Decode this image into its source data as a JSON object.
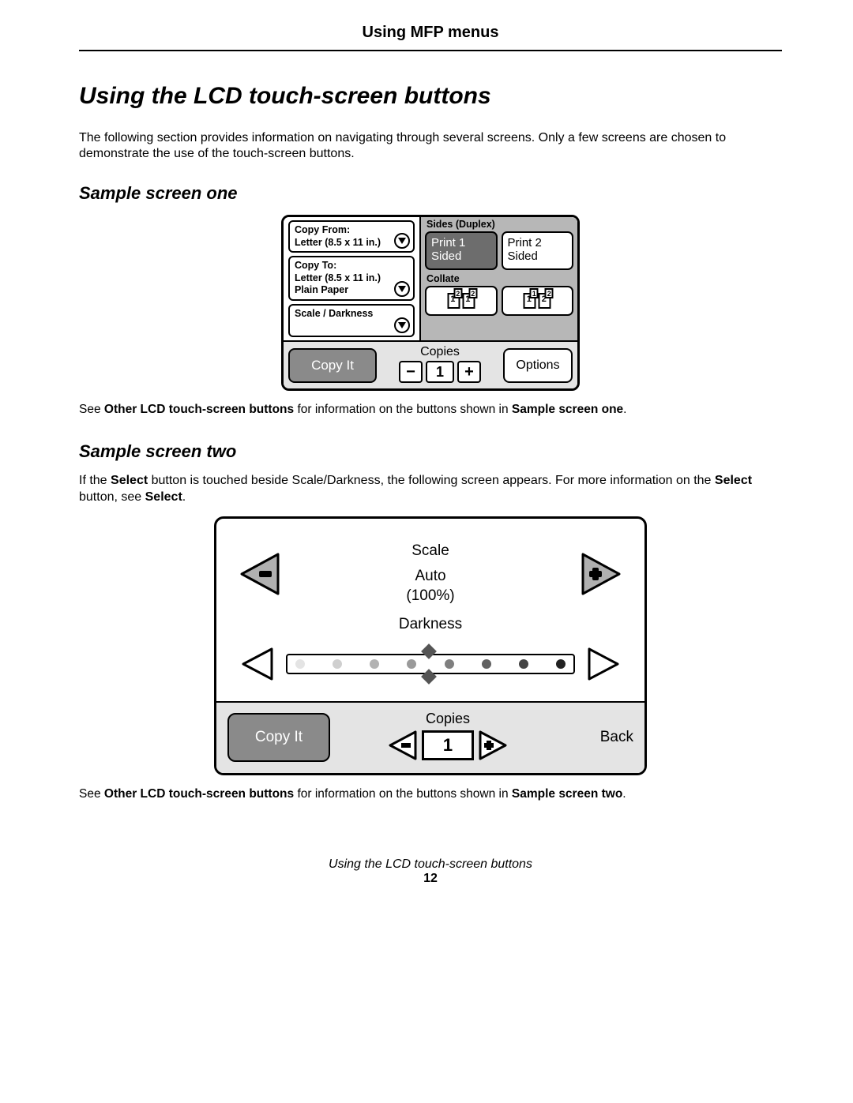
{
  "chapter": "Using MFP menus",
  "title": "Using the LCD touch-screen buttons",
  "intro": "The following section provides information on navigating through several screens. Only a few screens are chosen to demonstrate the use of the touch-screen buttons.",
  "s1": {
    "heading": "Sample screen one",
    "left": {
      "copy_from_label": "Copy From:",
      "copy_from_value": "Letter (8.5 x 11 in.)",
      "copy_to_label": "Copy To:",
      "copy_to_value": "Letter (8.5 x 11 in.)",
      "copy_to_media": "Plain Paper",
      "scale_label": "Scale / Darkness"
    },
    "right": {
      "sides_label": "Sides (Duplex)",
      "print1": "Print 1 Sided",
      "print2": "Print 2 Sided",
      "collate_label": "Collate",
      "collate_a": "12 12",
      "collate_b": "11 22"
    },
    "bottom": {
      "copy_it": "Copy It",
      "copies_label": "Copies",
      "copies_value": "1",
      "options": "Options"
    },
    "caption_pre": "See ",
    "caption_b1": "Other LCD touch-screen buttons",
    "caption_mid": " for information on the buttons shown in ",
    "caption_b2": "Sample screen one",
    "caption_end": "."
  },
  "s2": {
    "heading": "Sample screen two",
    "lead_pre": "If the ",
    "lead_b1": "Select",
    "lead_mid": " button is touched beside Scale/Darkness, the following screen appears. For more information on the ",
    "lead_b2": "Select",
    "lead_mid2": " button, see ",
    "lead_b3": "Select",
    "lead_end": ".",
    "scale_label": "Scale",
    "scale_value1": "Auto",
    "scale_value2": "(100%)",
    "darkness_label": "Darkness",
    "bottom": {
      "copy_it": "Copy It",
      "copies_label": "Copies",
      "copies_value": "1",
      "back": "Back"
    },
    "caption_pre": "See ",
    "caption_b1": "Other LCD touch-screen buttons",
    "caption_mid": " for information on the buttons shown in ",
    "caption_b2": "Sample screen two",
    "caption_end": "."
  },
  "footer_title": "Using the LCD touch-screen buttons",
  "page_number": "12"
}
